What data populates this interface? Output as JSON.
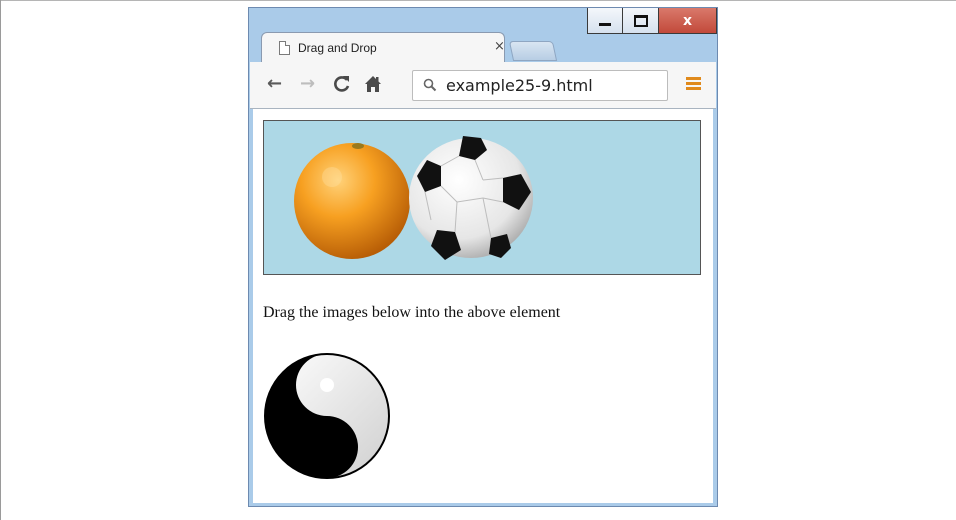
{
  "browser": {
    "tab_title": "Drag and Drop",
    "tab_close": "×",
    "url": "example25-9.html",
    "window_buttons": [
      "minimize-icon",
      "maximize-icon",
      "close-icon"
    ],
    "close_glyph": "x"
  },
  "toolbar": {
    "icons": [
      "back-icon",
      "forward-icon",
      "reload-icon",
      "home-icon",
      "search-icon",
      "menu-icon"
    ]
  },
  "page": {
    "instruction": "Drag the images below into the above element",
    "dropzone_color": "#add8e6",
    "dropzone_items": [
      "orange",
      "soccer-ball"
    ],
    "draggable_items": [
      "yin-yang"
    ]
  },
  "colors": {
    "titlebar": "#aacbe9",
    "close_button": "#c75040",
    "menu_accent": "#e08a1c"
  }
}
